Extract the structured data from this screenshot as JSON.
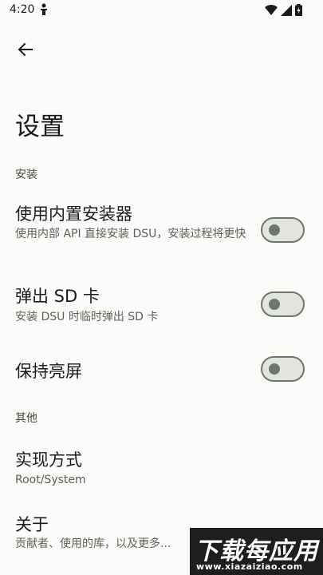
{
  "status_bar": {
    "time": "4:20",
    "left_icon": "accessibility-icon",
    "right_icons": [
      "wifi-icon",
      "cellular-signal-icon",
      "battery-charging-icon"
    ]
  },
  "toolbar": {
    "back_icon": "arrow-back-icon"
  },
  "page": {
    "title": "设置"
  },
  "sections": {
    "install": {
      "header": "安装"
    },
    "other": {
      "header": "其他"
    }
  },
  "preferences": {
    "builtin_installer": {
      "title": "使用内置安装器",
      "summary": "使用内部 API 直接安装 DSU，安装过程将更快",
      "enabled": false
    },
    "eject_sd": {
      "title": "弹出 SD 卡",
      "summary": "安装 DSU 时临时弹出 SD 卡",
      "enabled": false
    },
    "keep_screen_on": {
      "title": "保持亮屏",
      "enabled": false
    },
    "implementation": {
      "title": "实现方式",
      "summary": "Root/System"
    },
    "about": {
      "title": "关于",
      "summary": "贡献者、使用的库，以及更多..."
    }
  },
  "watermark": {
    "main_text": "下载每应用",
    "sub_text": "www.xiazaiziao.com"
  },
  "colors": {
    "background": "#fbfcfa",
    "toggle_off_track": "#e1e4df",
    "toggle_off_outline": "#6f776c"
  }
}
